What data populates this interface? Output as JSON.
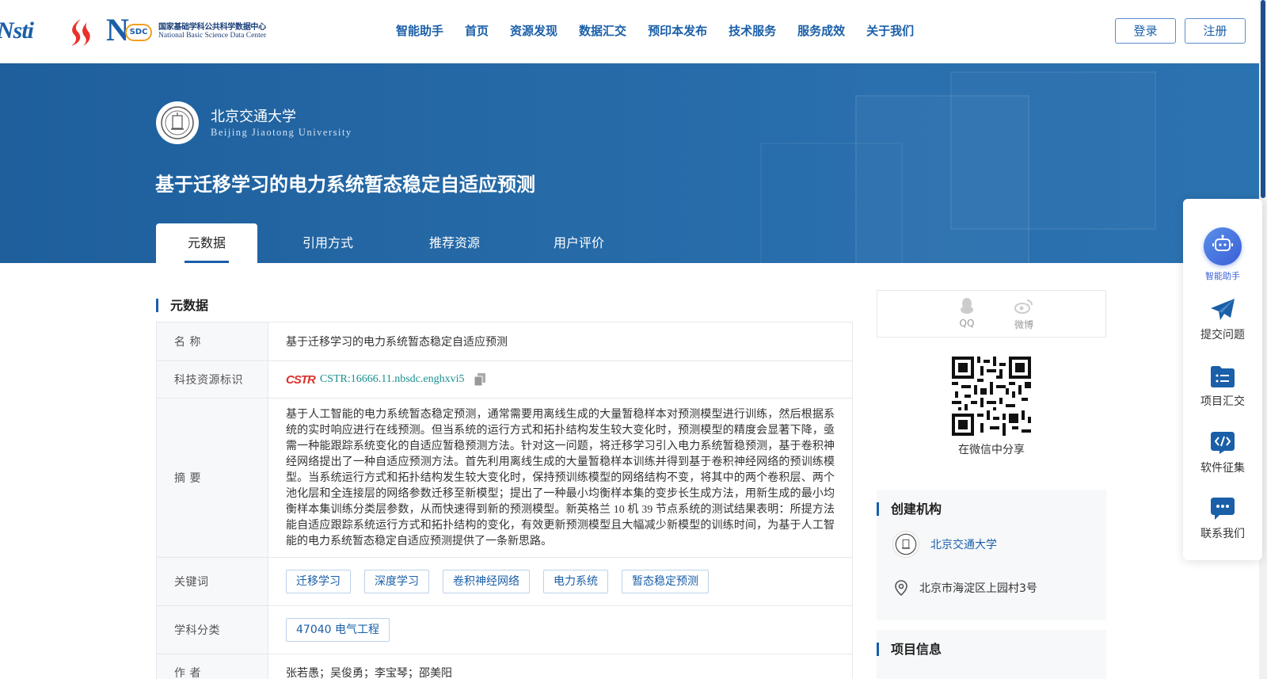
{
  "header": {
    "logo_cstr": "Nsti",
    "logo_nsdc_cn": "国家基础学科公共科学数据中心",
    "logo_nsdc_en": "National Basic Science Data Center",
    "logo_nsdc_mark": "SDC",
    "nav": [
      "智能助手",
      "首页",
      "资源发现",
      "数据汇交",
      "预印本发布",
      "技术服务",
      "服务成效",
      "关于我们"
    ],
    "login": "登录",
    "register": "注册"
  },
  "banner": {
    "university_cn": "北京交通大学",
    "university_en": "Beijing Jiaotong University",
    "title": "基于迁移学习的电力系统暂态稳定自适应预测",
    "tabs": [
      "元数据",
      "引用方式",
      "推荐资源",
      "用户评价"
    ]
  },
  "metadata": {
    "section_title": "元数据",
    "name_label": "名  称",
    "name_value": "基于迁移学习的电力系统暂态稳定自适应预测",
    "cstr_label": "科技资源标识",
    "cstr_logo": "CSTR",
    "cstr_value": "CSTR:16666.11.nbsdc.enghxvi5",
    "abstract_label": "摘  要",
    "abstract_value": "基于人工智能的电力系统暂态稳定预测，通常需要用离线生成的大量暂稳样本对预测模型进行训练，然后根据系统的实时响应进行在线预测。但当系统的运行方式和拓扑结构发生较大变化时，预测模型的精度会显著下降，亟需一种能跟踪系统变化的自适应暂稳预测方法。针对这一问题，将迁移学习引入电力系统暂稳预测，基于卷积神经网络提出了一种自适应预测方法。首先利用离线生成的大量暂稳样本训练并得到基于卷积神经网络的预训练模型。当系统运行方式和拓扑结构发生较大变化时，保持预训练模型的网络结构不变，将其中的两个卷积层、两个池化层和全连接层的网络参数迁移至新模型；提出了一种最小均衡样本集的变步长生成方法，用新生成的最小均衡样本集训练分类层参数，从而快速得到新的预测模型。新英格兰 10 机 39 节点系统的测试结果表明：所提方法能自适应跟踪系统运行方式和拓扑结构的变化，有效更新预测模型且大幅减少新模型的训练时间，为基于人工智能的电力系统暂态稳定自适应预测提供了一条新思路。",
    "keywords_label": "关键词",
    "keywords": [
      "迁移学习",
      "深度学习",
      "卷积神经网络",
      "电力系统",
      "暂态稳定预测"
    ],
    "subject_label": "学科分类",
    "subjects": [
      "47040 电气工程"
    ],
    "authors_label": "作  者",
    "authors_value": "张若愚；吴俊勇；李宝琴；邵美阳"
  },
  "share": {
    "qq": "QQ",
    "weibo": "微博",
    "wechat_caption": "在微信中分享"
  },
  "org": {
    "title": "创建机构",
    "name": "北京交通大学",
    "address": "北京市海淀区上园村3号"
  },
  "project": {
    "title": "项目信息"
  },
  "float_bar": {
    "ai": "智能助手",
    "submit": "提交问题",
    "collect": "项目汇交",
    "software": "软件征集",
    "contact": "联系我们"
  },
  "colors": {
    "brand": "#1a5fa8",
    "banner": "#2569a6",
    "ai_accent": "#3b5fd8"
  }
}
